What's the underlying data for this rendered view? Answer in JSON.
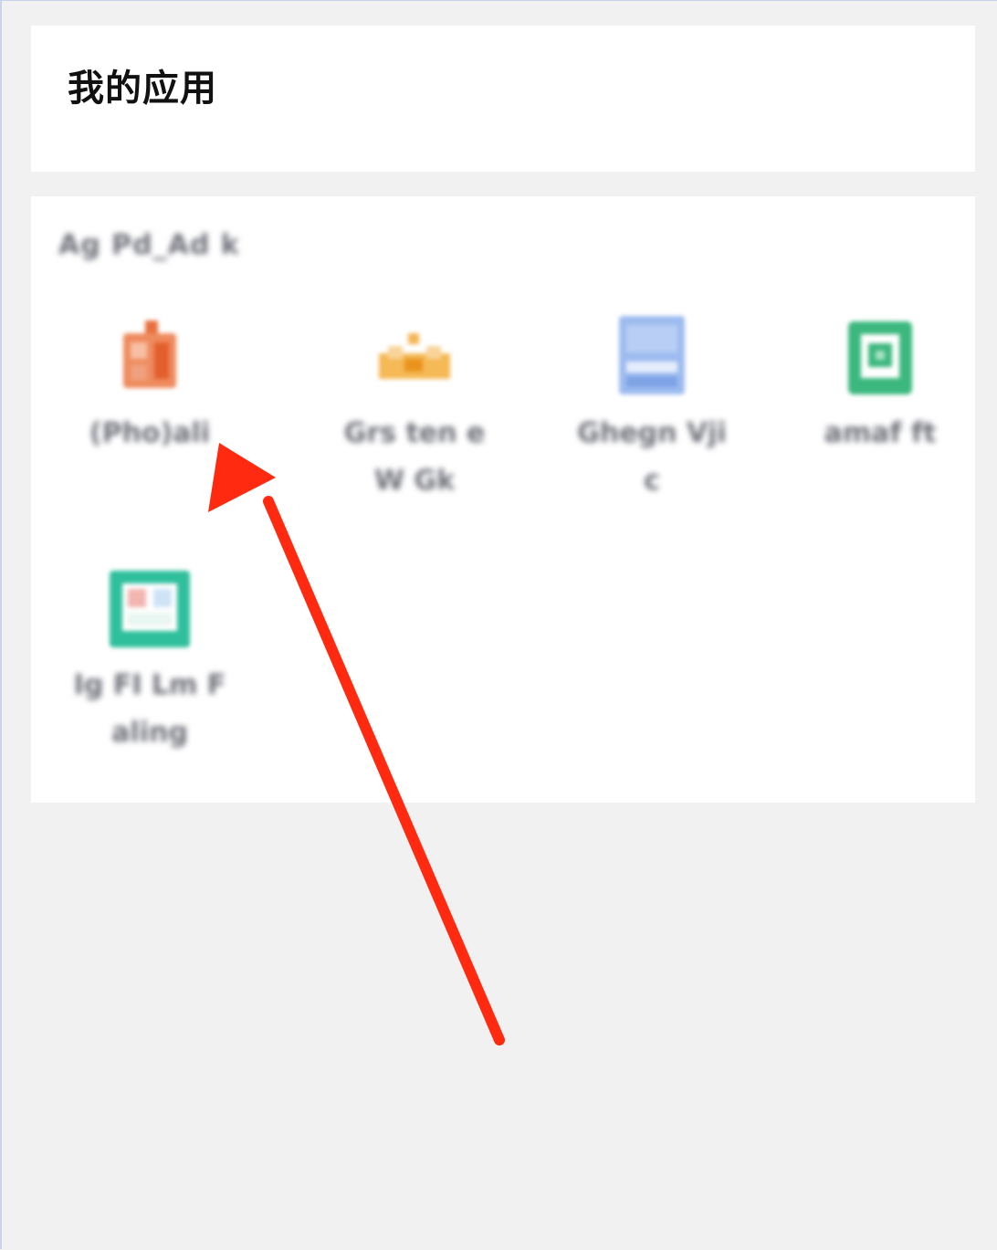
{
  "header": {
    "title": "我的应用"
  },
  "app_group": {
    "label": "Ag Pd_Ad k",
    "apps": [
      {
        "name": "(Pho)ali",
        "icon": "orange-app-icon",
        "color": "#e8703f"
      },
      {
        "name": "Grs ten e W Gk",
        "icon": "crown-icon",
        "color": "#efa93d"
      },
      {
        "name": "Ghegn Vjic",
        "icon": "blue-app-icon",
        "color": "#8fb3ea"
      },
      {
        "name": "amaf ft",
        "icon": "green-app-icon",
        "color": "#3cb87e"
      },
      {
        "name": "Ig FI Lm Faling",
        "icon": "teal-app-icon",
        "color": "#2fbf9c"
      }
    ]
  },
  "annotation": {
    "arrow_color": "#ff2a0f"
  }
}
